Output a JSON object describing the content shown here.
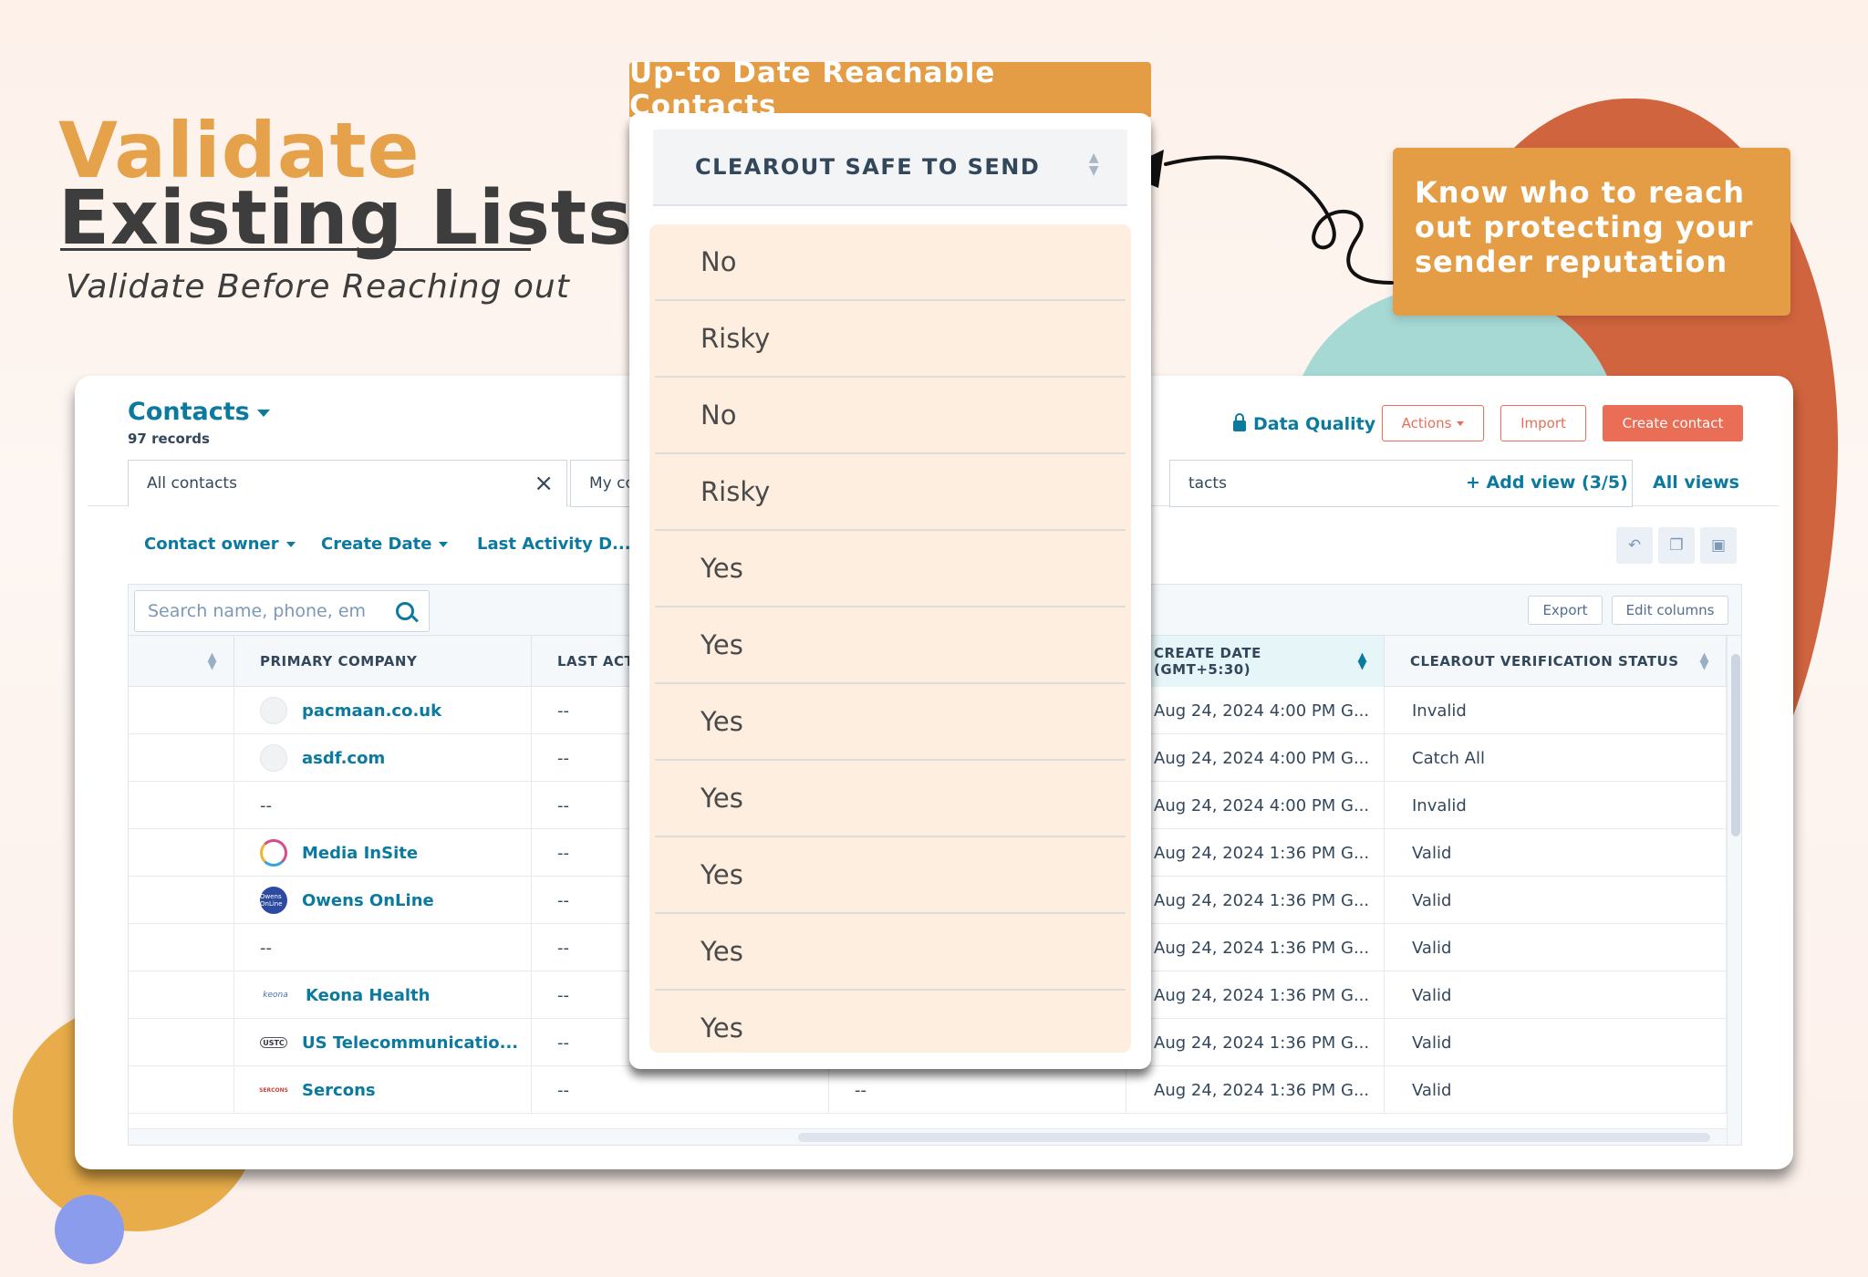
{
  "hero": {
    "title_line1": "Validate",
    "title_line2": "Existing Lists",
    "subtitle": "Validate Before Reaching out"
  },
  "callout": {
    "text": "Know who to reach out protecting your sender reputation"
  },
  "dropdown": {
    "header": "Up-to Date Reachable Contacts",
    "field_label": "CLEAROUT SAFE TO SEND",
    "options": [
      "No",
      "Risky",
      "No",
      "Risky",
      "Yes",
      "Yes",
      "Yes",
      "Yes",
      "Yes",
      "Yes",
      "Yes"
    ]
  },
  "crm": {
    "title": "Contacts",
    "records": "97 records",
    "data_quality": "Data Quality",
    "actions": "Actions",
    "import": "Import",
    "create_contact": "Create contact",
    "tabs": {
      "all": "All contacts",
      "my": "My co",
      "mid": "tacts"
    },
    "add_view": "Add view (3/5)",
    "all_views": "All views",
    "filters": [
      "Contact owner",
      "Create Date",
      "Last Activity D..."
    ],
    "search_placeholder": "Search name, phone, em",
    "export": "Export",
    "edit_columns": "Edit columns",
    "columns": {
      "company": "PRIMARY COMPANY",
      "last_activity": "LAST ACTI",
      "create_date": "CREATE DATE (GMT+5:30)",
      "status": "CLEAROUT VERIFICATION STATUS"
    },
    "rows": [
      {
        "company": "pacmaan.co.uk",
        "logo": "gray",
        "last": "--",
        "mid": "",
        "date": "Aug 24, 2024 4:00 PM G...",
        "status": "Invalid"
      },
      {
        "company": "asdf.com",
        "logo": "gray",
        "last": "--",
        "mid": "",
        "date": "Aug 24, 2024 4:00 PM G...",
        "status": "Catch All"
      },
      {
        "company": "--",
        "logo": "",
        "last": "--",
        "mid": "",
        "date": "Aug 24, 2024 4:00 PM G...",
        "status": "Invalid"
      },
      {
        "company": "Media InSite",
        "logo": "media",
        "last": "--",
        "mid": "",
        "date": "Aug 24, 2024 1:36 PM G...",
        "status": "Valid"
      },
      {
        "company": "Owens OnLine",
        "logo": "owens",
        "last": "--",
        "mid": "",
        "date": "Aug 24, 2024 1:36 PM G...",
        "status": "Valid"
      },
      {
        "company": "--",
        "logo": "",
        "last": "--",
        "mid": "",
        "date": "Aug 24, 2024 1:36 PM G...",
        "status": "Valid"
      },
      {
        "company": "Keona Health",
        "logo": "keona",
        "last": "--",
        "mid": "",
        "date": "Aug 24, 2024 1:36 PM G...",
        "status": "Valid"
      },
      {
        "company": "US Telecommunicatio...",
        "logo": "usti",
        "last": "--",
        "mid": "",
        "date": "Aug 24, 2024 1:36 PM G...",
        "status": "Valid"
      },
      {
        "company": "Sercons",
        "logo": "sercons",
        "last": "--",
        "mid": "--",
        "date": "Aug 24, 2024 1:36 PM G...",
        "status": "Valid"
      }
    ],
    "logo_text": {
      "owens": "Owens OnLine",
      "keona": "keona",
      "usti": "USTC",
      "sercons": "SERCONS"
    }
  },
  "colors": {
    "accent_orange": "#e49d45",
    "link_teal": "#0b7a9e",
    "button_coral": "#ea6d56",
    "deco_red": "#d0643f",
    "deco_teal": "#a7d9d4"
  }
}
